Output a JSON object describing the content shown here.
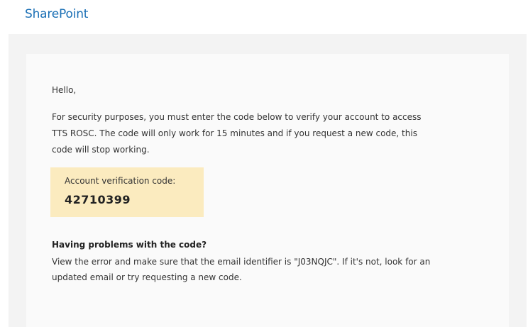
{
  "header": {
    "brand": "SharePoint"
  },
  "email": {
    "greeting": "Hello,",
    "message_lines": [
      "For security purposes, you must enter the code below to verify your account to access",
      "TTS ROSC. The code will only work for 15 minutes and if you request a new code, this",
      "code will stop working."
    ],
    "code_label": "Account verification code:",
    "code_value": "42710399",
    "help_title": "Having problems with the code?",
    "help_lines": [
      "View the error and make sure that the email identifier is \"J03NQJC\". If it's not, look for an",
      "updated email or try requesting a new code."
    ]
  },
  "colors": {
    "brand": "#1a6fb5",
    "code_highlight": "#fbebbf",
    "outer_background": "#f3f3f3",
    "card_background": "#fafafa"
  }
}
